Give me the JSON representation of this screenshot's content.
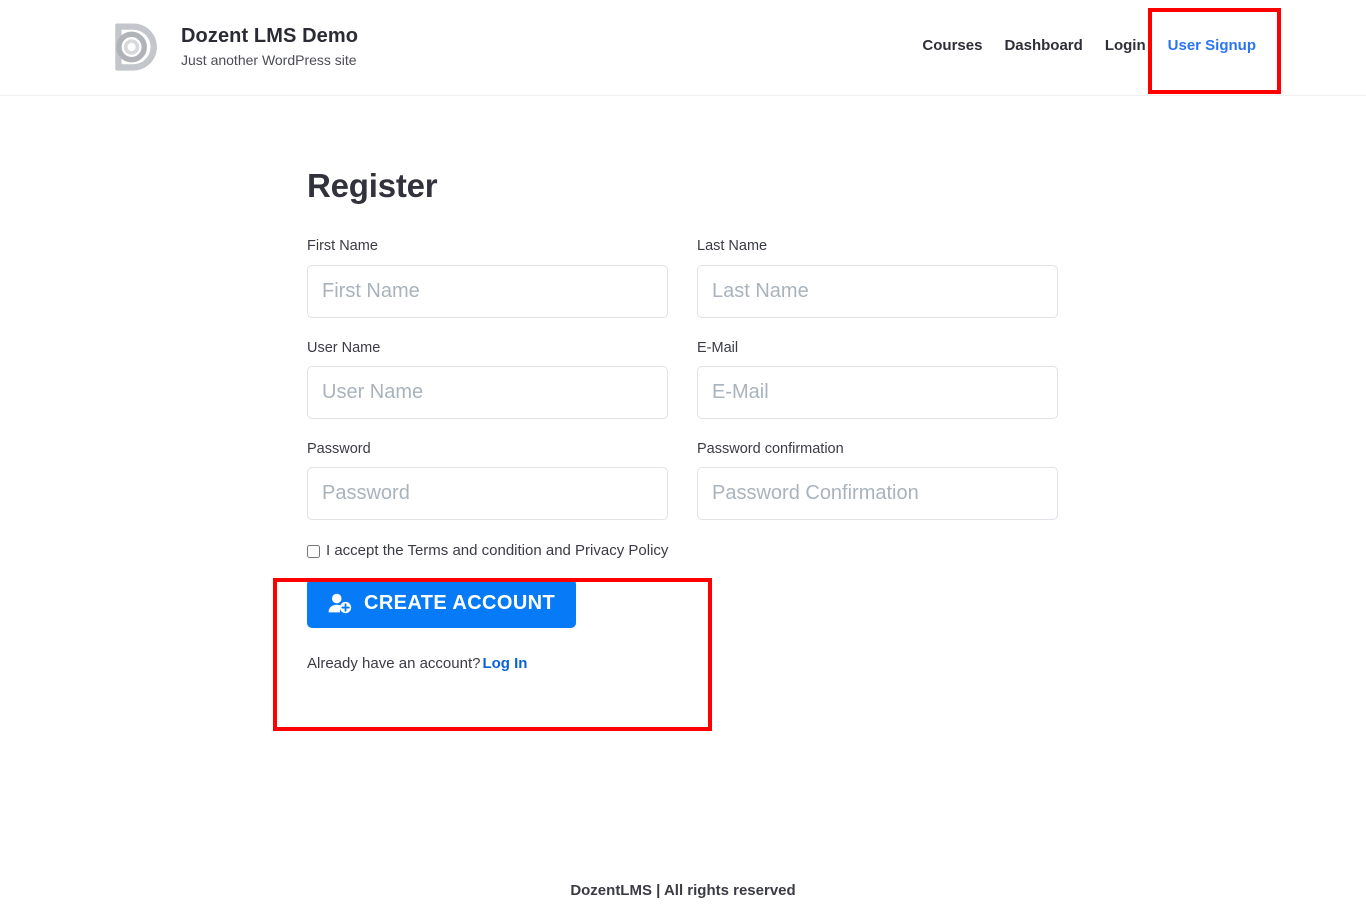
{
  "header": {
    "logo_icon": "dozent-d-logo-icon",
    "brand_title": "Dozent LMS Demo",
    "brand_tagline": "Just another WordPress site",
    "nav": [
      {
        "label": "Courses",
        "active": false
      },
      {
        "label": "Dashboard",
        "active": false
      },
      {
        "label": "Login",
        "active": false
      },
      {
        "label": "User Signup",
        "active": true
      }
    ]
  },
  "main": {
    "page_title": "Register",
    "fields": [
      {
        "label": "First Name",
        "placeholder": "First Name",
        "value": "",
        "type": "text"
      },
      {
        "label": "Last Name",
        "placeholder": "Last Name",
        "value": "",
        "type": "text"
      },
      {
        "label": "User Name",
        "placeholder": "User Name",
        "value": "",
        "type": "text"
      },
      {
        "label": "E-Mail",
        "placeholder": "E-Mail",
        "value": "",
        "type": "email"
      },
      {
        "label": "Password",
        "placeholder": "Password",
        "value": "",
        "type": "password"
      },
      {
        "label": "Password confirmation",
        "placeholder": "Password Confirmation",
        "value": "",
        "type": "password"
      }
    ],
    "terms": {
      "checked": false,
      "text": "I accept the Terms and condition and Privacy Policy"
    },
    "submit": {
      "label": "CREATE ACCOUNT",
      "icon": "user-plus-icon"
    },
    "login_hint": {
      "text": "Already have an account?",
      "link_label": "Log In"
    }
  },
  "footer": {
    "text": "DozentLMS | All rights reserved"
  },
  "annotations": [
    {
      "name": "user-signup-highlight",
      "color": "#fe0000"
    },
    {
      "name": "submit-area-highlight",
      "color": "#fe0000"
    }
  ],
  "colors": {
    "accent_blue": "#077bf7",
    "link_blue": "#2b76f0",
    "annotation_red": "#fe0000",
    "text_dark": "#32323c",
    "placeholder_gray": "#a9b3bd",
    "input_border": "#dfe2e6",
    "logo_gray": "#b4b7bb"
  }
}
